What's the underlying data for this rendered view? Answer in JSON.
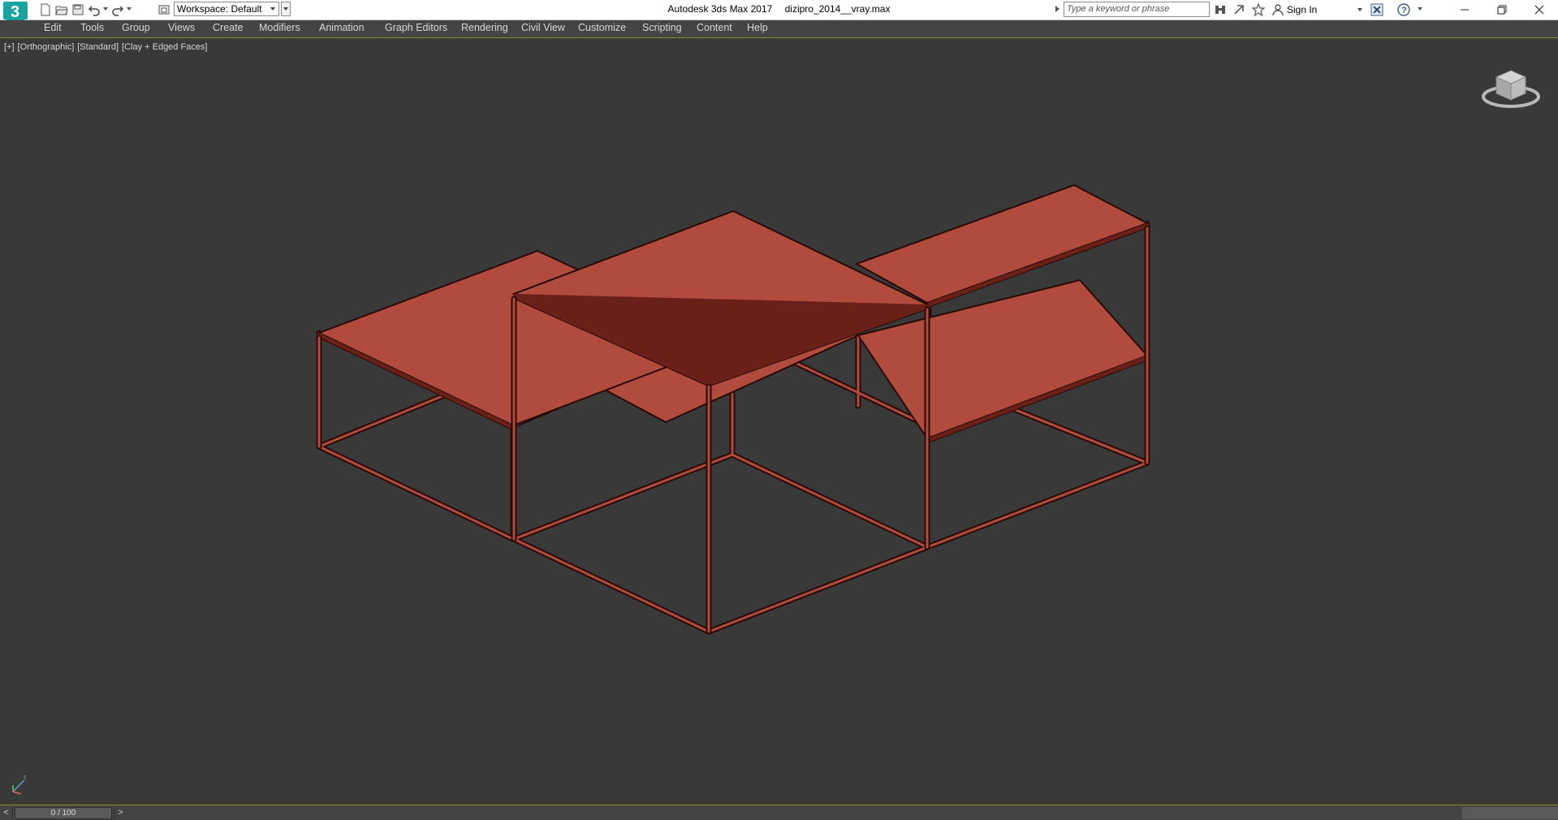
{
  "window": {
    "app_title": "Autodesk 3ds Max 2017",
    "file_name": "dizipro_2014__vray.max"
  },
  "toolbar": {
    "workspace_label": "Workspace: Default"
  },
  "search": {
    "placeholder": "Type a keyword or phrase"
  },
  "account": {
    "sign_in_label": "Sign In"
  },
  "menu": {
    "items": [
      {
        "label": "Edit"
      },
      {
        "label": "Tools"
      },
      {
        "label": "Group"
      },
      {
        "label": "Views"
      },
      {
        "label": "Create"
      },
      {
        "label": "Modifiers"
      },
      {
        "label": "Animation"
      },
      {
        "label": "Graph Editors"
      },
      {
        "label": "Rendering"
      },
      {
        "label": "Civil View"
      },
      {
        "label": "Customize"
      },
      {
        "label": "Scripting"
      },
      {
        "label": "Content"
      },
      {
        "label": "Help"
      }
    ]
  },
  "viewport": {
    "labels": {
      "plus": "[+]",
      "projection": "[Orthographic]",
      "shading_standard": "[Standard]",
      "shading_mode": "[Clay + Edged Faces]"
    },
    "object_color": "#b04b3e",
    "background_color": "#393939"
  },
  "timeline": {
    "prev_label": "<",
    "next_label": ">",
    "frame_display": "0 / 100",
    "current_frame": 0,
    "total_frames": 100
  },
  "icons": {
    "app_logo": "3ds-max-logo",
    "new": "new-file-icon",
    "open": "open-file-icon",
    "save": "save-icon",
    "undo": "undo-icon",
    "redo": "redo-icon",
    "project": "project-folder-icon",
    "binoculars": "binoculars-icon",
    "subscription": "subscription-icon",
    "favorites": "star-icon",
    "user": "user-icon",
    "exchange": "exchange-icon",
    "help": "help-icon",
    "minimize": "minimize-icon",
    "restore": "restore-icon",
    "close": "close-icon",
    "viewcube": "viewcube-icon",
    "axis": "axis-tripod-icon"
  }
}
